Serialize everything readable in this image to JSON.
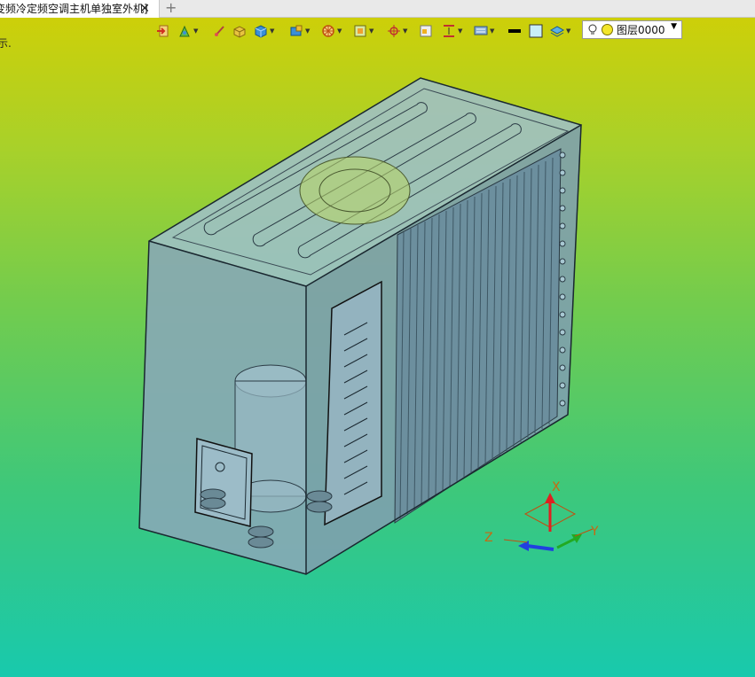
{
  "tab": {
    "title": "变频冷定频空调主机单独室外机]",
    "close_icon": "close-icon",
    "new_tab_icon": "plus-icon"
  },
  "layer": {
    "value": "图层0000"
  },
  "hint": {
    "text": "示."
  },
  "triad": {
    "x_label": "X",
    "y_label": "Y",
    "z_label": "Z"
  },
  "toolbar_icons": [
    "exit-sketch-icon",
    "paint-bucket-icon",
    "brush-icon",
    "box-icon",
    "cube-icon",
    "render-style-icon",
    "wheel-icon",
    "view-frame-icon",
    "crosshair-icon",
    "grid-icon",
    "align-icon",
    "monitor-icon",
    "line-color-icon",
    "fill-color-icon",
    "layer-stack-icon",
    "bulb-icon",
    "layer-dot-icon"
  ],
  "colors": {
    "bg_top": "#d2cf04",
    "bg_bottom": "#18c9ad",
    "model": "#8aaec0",
    "edge": "#2a3a44",
    "axis_x": "#e02020",
    "axis_y": "#22aa22",
    "axis_z": "#2040e0"
  }
}
